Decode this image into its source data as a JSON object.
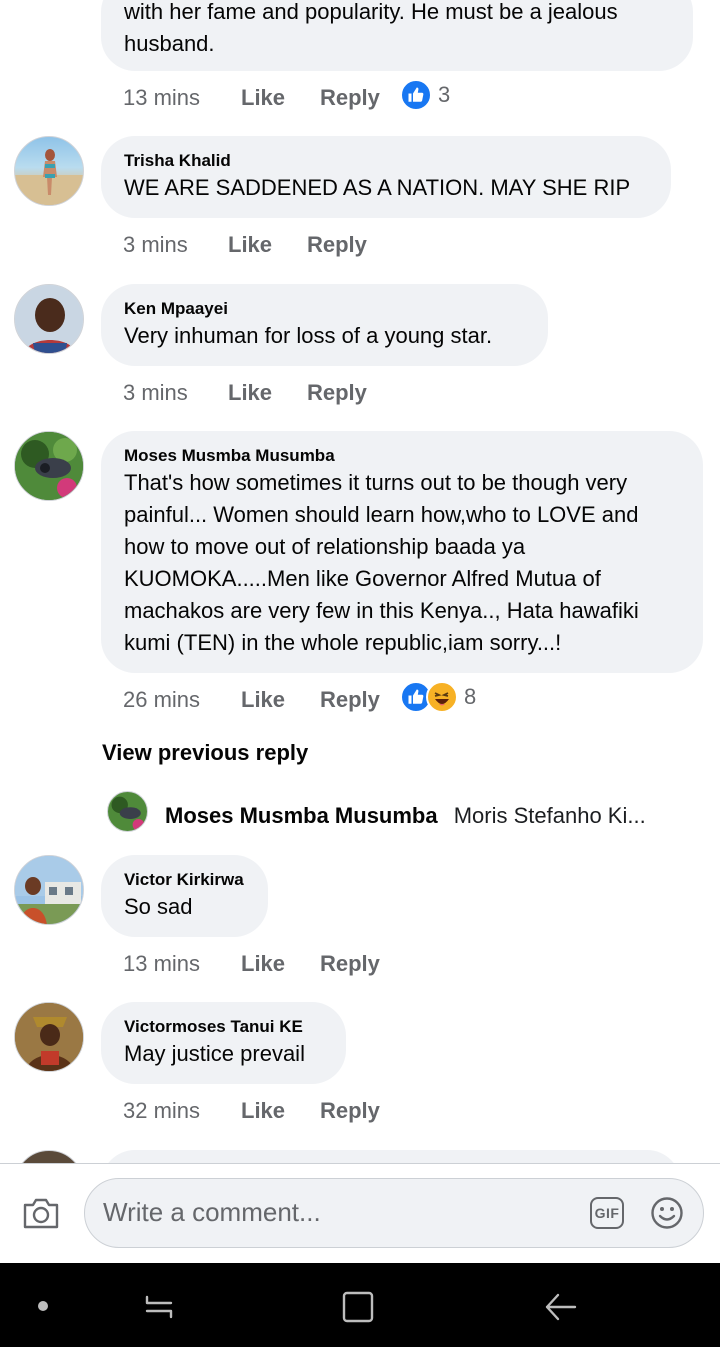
{
  "comments": [
    {
      "text": "with her fame and popularity.  He must be a jealous husband.",
      "time": "13 mins",
      "like": "Like",
      "reply": "Reply",
      "reactions": "3"
    },
    {
      "author": "Trisha Khalid",
      "text": "WE ARE SADDENED AS A NATION. MAY SHE RIP",
      "time": "3 mins",
      "like": "Like",
      "reply": "Reply"
    },
    {
      "author": "Ken Mpaayei",
      "text": "Very inhuman for loss of a young star.",
      "time": "3 mins",
      "like": "Like",
      "reply": "Reply"
    },
    {
      "author": "Moses Musmba Musumba",
      "text": "That's how sometimes it turns out to be though very painful... Women should learn how,who to LOVE and how to move out of relationship baada ya KUOMOKA.....Men like Governor Alfred Mutua of machakos are very few in this Kenya.., Hata hawafiki kumi (TEN) in the whole republic,iam sorry...!",
      "time": "26 mins",
      "like": "Like",
      "reply": "Reply",
      "reactions": "8",
      "view_previous": "View previous reply",
      "reply_preview": {
        "author": "Moses Musmba Musumba",
        "snippet": "Moris Stefanho Ki..."
      }
    },
    {
      "author": "Victor Kirkirwa",
      "text": "So sad",
      "time": "13 mins",
      "like": "Like",
      "reply": "Reply"
    },
    {
      "author": "Victormoses Tanui KE",
      "text": "May justice prevail",
      "time": "32 mins",
      "like": "Like",
      "reply": "Reply"
    }
  ],
  "composer": {
    "placeholder": "Write a comment...",
    "camera_icon": "camera-icon",
    "gif_label": "GIF",
    "emoji_icon": "emoji-icon"
  },
  "colors": {
    "bubble": "#f0f2f5",
    "meta_text": "#65676b",
    "like_blue": "#1877f2",
    "haha_yellow": "#f7b125",
    "nav_bar": "#000000"
  }
}
